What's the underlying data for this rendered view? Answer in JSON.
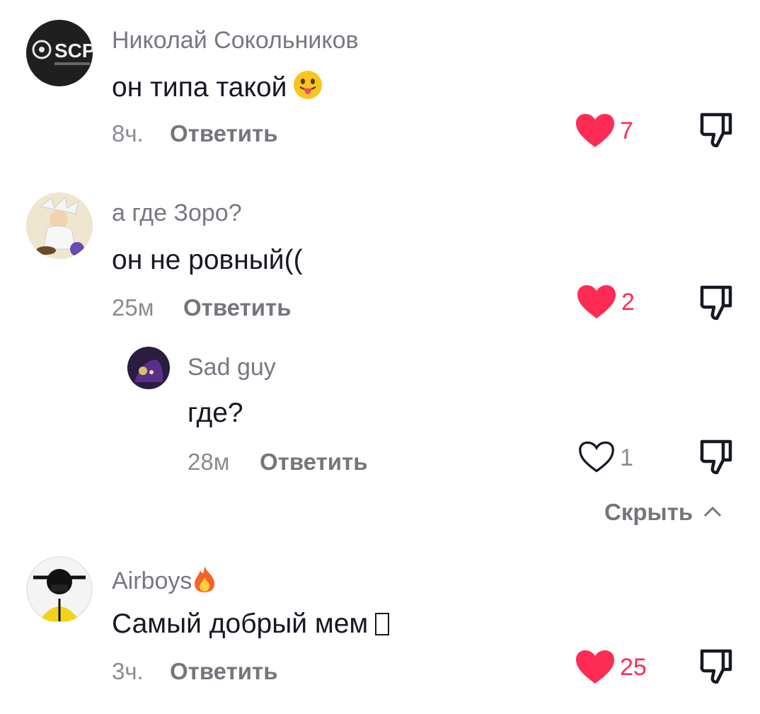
{
  "comments": [
    {
      "username": "Николай Сокольников",
      "text": "он типа такой",
      "time": "8ч.",
      "reply_label": "Ответить",
      "likes": "7",
      "liked": true,
      "avatar": "scp-logo",
      "avatar_text": "SCP"
    },
    {
      "username": "а где Зоро?",
      "text": "он не ровный((",
      "time": "25м",
      "reply_label": "Ответить",
      "likes": "2",
      "liked": true,
      "avatar": "anime-character"
    },
    {
      "username": "Airboys",
      "text": "Самый добрый мем",
      "time": "3ч.",
      "reply_label": "Ответить",
      "likes": "25",
      "liked": true,
      "avatar": "gasmask-figure"
    }
  ],
  "reply": {
    "username": "Sad guy",
    "text": "где?",
    "time": "28м",
    "reply_label": "Ответить",
    "likes": "1",
    "liked": false,
    "avatar": "dark-purple"
  },
  "hide_label": "Скрыть",
  "colors": {
    "like_red": "#fe2c55",
    "text": "#161823",
    "muted": "#777880"
  },
  "icons": [
    "heart-filled-icon",
    "heart-outline-icon",
    "dislike-icon",
    "chevron-up-icon",
    "tongue-emoji-icon",
    "fire-emoji-icon"
  ]
}
